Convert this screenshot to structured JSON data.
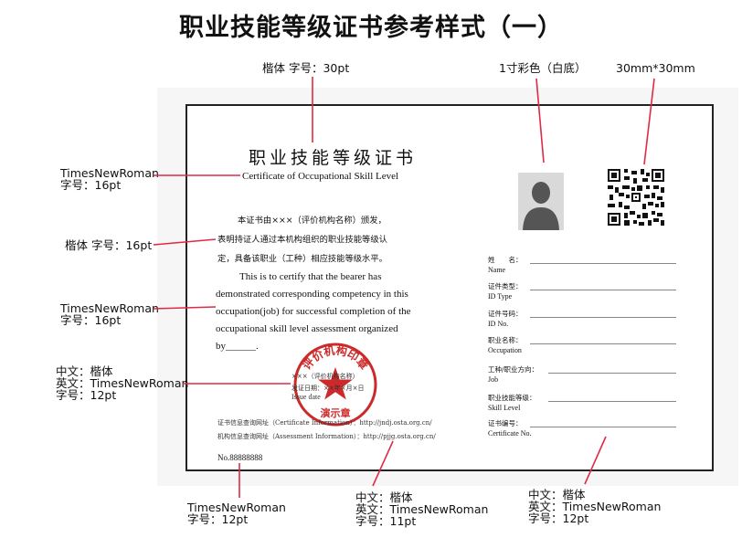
{
  "page_title": "职业技能等级证书参考样式（一）",
  "annotations": {
    "title_font": "楷体 字号：30pt",
    "photo_note": "1寸彩色（白底）",
    "qr_size": "30mm*30mm",
    "en_title_font": [
      "TimesNewRoman",
      "字号：16pt"
    ],
    "zh_body_font": "楷体 字号：16pt",
    "en_body_font": [
      "TimesNewRoman",
      "字号：16pt"
    ],
    "seal_font": [
      "中文：楷体",
      "英文：TimesNewRoman",
      "字号：12pt"
    ],
    "serial_font": [
      "TimesNewRoman",
      "字号：12pt"
    ],
    "info_font": [
      "中文：楷体",
      "英文：TimesNewRoman",
      "字号：11pt"
    ],
    "fields_font": [
      "中文：楷体",
      "英文：TimesNewRoman",
      "字号：12pt"
    ]
  },
  "certificate": {
    "title_zh": "职业技能等级证书",
    "title_en": "Certificate of Occupational Skill Level",
    "body_zh": [
      "本证书由×××（评价机构名称）颁发，",
      "表明持证人通过本机构组织的职业技能等级认",
      "定，具备该职业（工种）相应技能等级水平。"
    ],
    "body_en": [
      "This is to certify that the bearer has",
      "demonstrated corresponding competency in this",
      "occupation(job) for successful completion of the",
      "occupational skill level assessment organized",
      "by______."
    ],
    "seal": {
      "ring_text": "评价机构印章",
      "center_text": "演示章",
      "issuer": "×××（评价机构名称）",
      "issue_date_zh": "发证日期：××年×月×日",
      "issue_date_en": "Issue date"
    },
    "info_lines": [
      "证书信息查询网址（Certificate Information）：http://jndj.osta.org.cn/",
      "机构信息查询网址（Assessment Information）：http://pjjg.osta.org.cn/"
    ],
    "serial_no": "No.88888888",
    "fields": [
      {
        "zh": "姓　　名：",
        "en": "Name"
      },
      {
        "zh": "证件类型：",
        "en": "ID Type"
      },
      {
        "zh": "证件号码：",
        "en": "ID No."
      },
      {
        "zh": "职业名称：",
        "en": "Occupation"
      },
      {
        "zh": "工种/职业方向：",
        "en": "Job"
      },
      {
        "zh": "职业技能等级：",
        "en": "Skill Level"
      },
      {
        "zh": "证书编号：",
        "en": "Certificate No."
      }
    ]
  },
  "colors": {
    "pointer": "#e02a45",
    "seal": "#cc2a2a"
  }
}
